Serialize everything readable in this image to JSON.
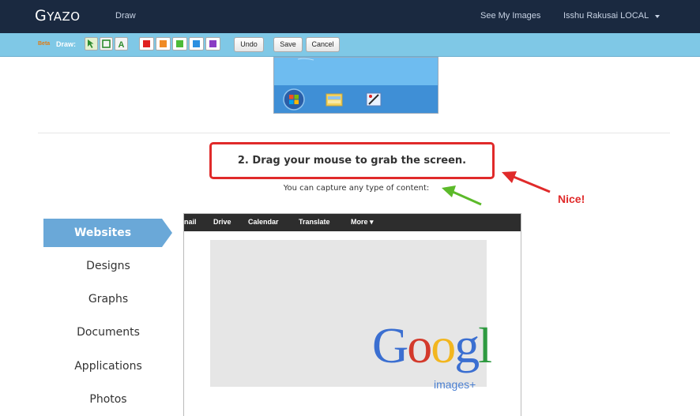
{
  "navbar": {
    "brand": "Gyazo",
    "section": "Draw",
    "links": [
      "See My Images"
    ],
    "user": "Isshu Rakusai LOCAL"
  },
  "toolbar": {
    "beta_label": "Beta",
    "draw_label": "Draw:",
    "tools": [
      {
        "name": "arrow-tool",
        "glyph": "↖"
      },
      {
        "name": "rectangle-tool",
        "glyph": "▢"
      },
      {
        "name": "text-tool",
        "glyph": "A"
      }
    ],
    "colors": [
      "#e02020",
      "#f08a24",
      "#4cbb38",
      "#2b8fe0",
      "#8a3cc4"
    ],
    "undo_label": "Undo",
    "save_label": "Save",
    "cancel_label": "Cancel"
  },
  "content": {
    "step_title": "2. Drag your mouse to grab the screen.",
    "step_subtitle": "You can capture any type of content:",
    "annotation": "Nice!",
    "annotation_color": "#e02a2a",
    "green_arrow_color": "#5cba2a"
  },
  "categories": [
    {
      "label": "Websites",
      "active": true
    },
    {
      "label": "Designs",
      "active": false
    },
    {
      "label": "Graphs",
      "active": false
    },
    {
      "label": "Documents",
      "active": false
    },
    {
      "label": "Applications",
      "active": false
    },
    {
      "label": "Photos",
      "active": false
    }
  ],
  "preview": {
    "google_nav": [
      "nail",
      "Drive",
      "Calendar",
      "Translate",
      "More ▾"
    ],
    "logo_letters": [
      {
        "ch": "G",
        "color": "#3b6fd1"
      },
      {
        "ch": "o",
        "color": "#d33a2c"
      },
      {
        "ch": "o",
        "color": "#f2b61f"
      },
      {
        "ch": "g",
        "color": "#3b6fd1"
      },
      {
        "ch": "l",
        "color": "#2e9a40"
      }
    ],
    "logo_suffix": "images+"
  }
}
